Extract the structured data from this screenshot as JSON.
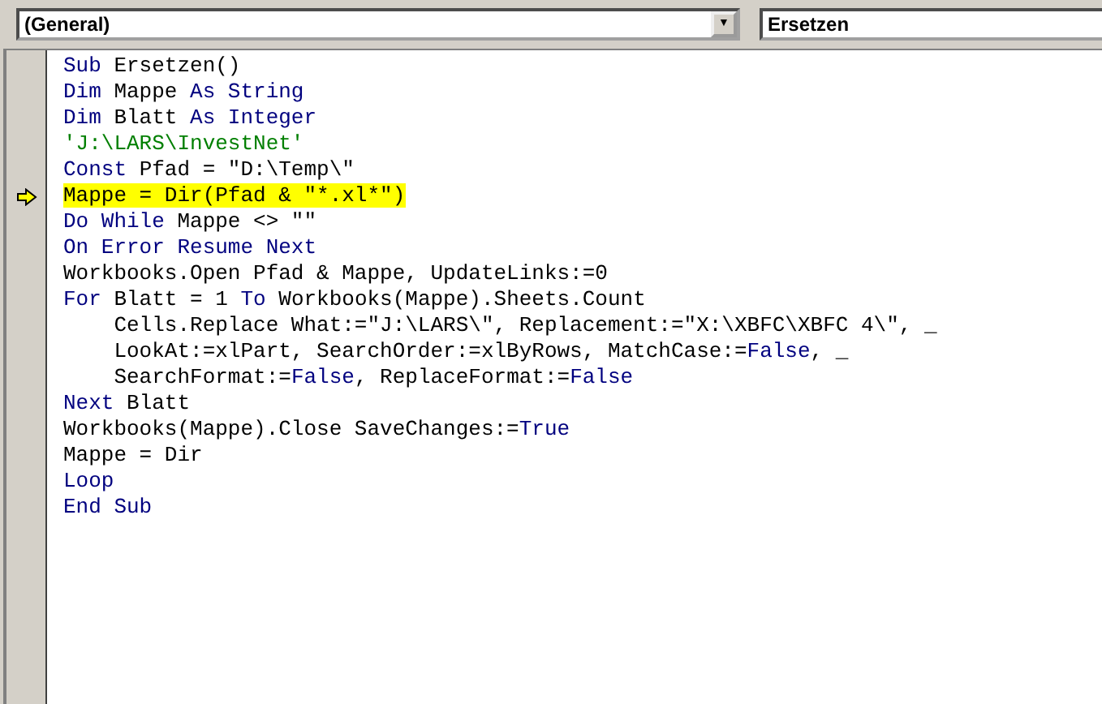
{
  "object_box": {
    "value": "(General)",
    "button": "▼"
  },
  "procedure_box": {
    "value": "Ersetzen"
  },
  "code_lines": [
    {
      "current": false,
      "tokens": [
        {
          "kind": "keyword",
          "text": "Sub"
        },
        {
          "kind": "plain",
          "text": " Ersetzen()"
        }
      ]
    },
    {
      "current": false,
      "tokens": [
        {
          "kind": "keyword",
          "text": "Dim"
        },
        {
          "kind": "plain",
          "text": " Mappe "
        },
        {
          "kind": "keyword",
          "text": "As String"
        }
      ]
    },
    {
      "current": false,
      "tokens": [
        {
          "kind": "keyword",
          "text": "Dim"
        },
        {
          "kind": "plain",
          "text": " Blatt "
        },
        {
          "kind": "keyword",
          "text": "As Integer"
        }
      ]
    },
    {
      "current": false,
      "tokens": [
        {
          "kind": "comment",
          "text": "'J:\\LARS\\InvestNet'"
        }
      ]
    },
    {
      "current": false,
      "tokens": [
        {
          "kind": "keyword",
          "text": "Const"
        },
        {
          "kind": "plain",
          "text": " Pfad = \"D:\\Temp\\\""
        }
      ]
    },
    {
      "current": true,
      "tokens": [
        {
          "kind": "plain",
          "text": "Mappe = Dir(Pfad & \"*.xl*\")"
        }
      ]
    },
    {
      "current": false,
      "tokens": [
        {
          "kind": "keyword",
          "text": "Do While"
        },
        {
          "kind": "plain",
          "text": " Mappe <> \"\""
        }
      ]
    },
    {
      "current": false,
      "tokens": [
        {
          "kind": "keyword",
          "text": "On Error Resume Next"
        }
      ]
    },
    {
      "current": false,
      "tokens": [
        {
          "kind": "plain",
          "text": "Workbooks.Open Pfad & Mappe, UpdateLinks:=0"
        }
      ]
    },
    {
      "current": false,
      "tokens": [
        {
          "kind": "keyword",
          "text": "For"
        },
        {
          "kind": "plain",
          "text": " Blatt = 1 "
        },
        {
          "kind": "keyword",
          "text": "To"
        },
        {
          "kind": "plain",
          "text": " Workbooks(Mappe).Sheets.Count"
        }
      ]
    },
    {
      "current": false,
      "tokens": [
        {
          "kind": "plain",
          "text": "    Cells.Replace What:=\"J:\\LARS\\\", Replacement:=\"X:\\XBFC\\XBFC 4\\\", _"
        }
      ]
    },
    {
      "current": false,
      "tokens": [
        {
          "kind": "plain",
          "text": "    LookAt:=xlPart, SearchOrder:=xlByRows, MatchCase:="
        },
        {
          "kind": "keyword",
          "text": "False"
        },
        {
          "kind": "plain",
          "text": ", _"
        }
      ]
    },
    {
      "current": false,
      "tokens": [
        {
          "kind": "plain",
          "text": "    SearchFormat:="
        },
        {
          "kind": "keyword",
          "text": "False"
        },
        {
          "kind": "plain",
          "text": ", ReplaceFormat:="
        },
        {
          "kind": "keyword",
          "text": "False"
        }
      ]
    },
    {
      "current": false,
      "tokens": [
        {
          "kind": "keyword",
          "text": "Next"
        },
        {
          "kind": "plain",
          "text": " Blatt"
        }
      ]
    },
    {
      "current": false,
      "tokens": [
        {
          "kind": "plain",
          "text": "Workbooks(Mappe).Close SaveChanges:="
        },
        {
          "kind": "keyword",
          "text": "True"
        }
      ]
    },
    {
      "current": false,
      "tokens": [
        {
          "kind": "plain",
          "text": "Mappe = Dir"
        }
      ]
    },
    {
      "current": false,
      "tokens": [
        {
          "kind": "keyword",
          "text": "Loop"
        }
      ]
    },
    {
      "current": false,
      "tokens": [
        {
          "kind": "keyword",
          "text": "End Sub"
        }
      ]
    }
  ]
}
